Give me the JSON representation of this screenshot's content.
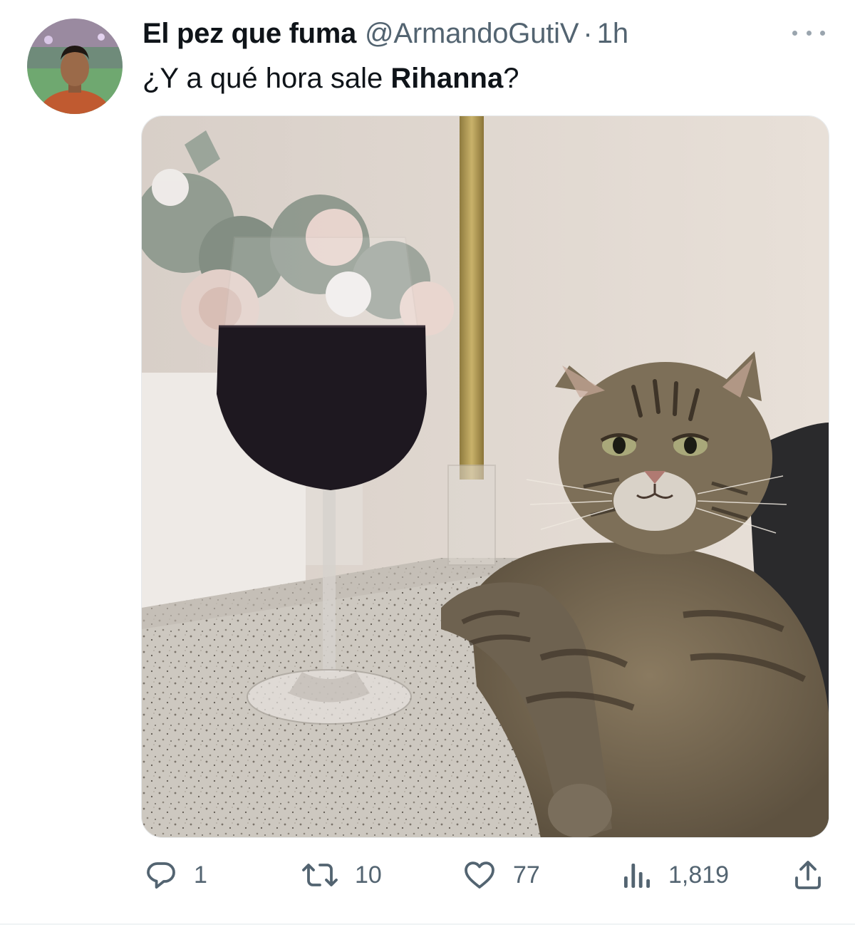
{
  "tweet": {
    "author_name": "El pez que fuma",
    "handle": "@ArmandoGutiV",
    "separator": "·",
    "time": "1h",
    "text_before": "¿Y a qué hora sale ",
    "text_bold": "Rihanna",
    "text_after": "?"
  },
  "actions": {
    "replies": "1",
    "retweets": "10",
    "likes": "77",
    "views": "1,819"
  },
  "colors": {
    "text_primary": "#0f1419",
    "text_secondary": "#536471",
    "icon": "#536471"
  },
  "icons": {
    "reply": "reply-icon",
    "retweet": "retweet-icon",
    "like": "heart-icon",
    "views": "views-icon",
    "share": "share-icon",
    "more": "more-icon"
  }
}
